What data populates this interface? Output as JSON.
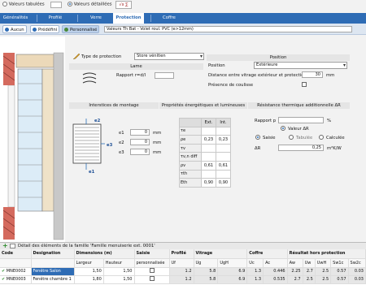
{
  "top": {
    "tabulated": "Valeurs tabulées",
    "detailed": "Valeurs détaillées",
    "formula": "√x ∑"
  },
  "tabs": [
    "Généralités",
    "Profilé",
    "Verre",
    "Protection",
    "Coffre"
  ],
  "active_tab": 3,
  "toolbar": {
    "none": "Aucun",
    "predefined": "Prédéfini",
    "custom": "Personnalisé",
    "title_field": "Valeurs Th Bat - Volet roul. PVC (e>12mm)"
  },
  "protection": {
    "type_label": "Type de protection",
    "type_value": "Store vénitien"
  },
  "lame": {
    "header": "Lame",
    "ratio_label": "Rapport r=d/l",
    "ratio_value": ""
  },
  "position": {
    "header": "Position",
    "pos_label": "Position",
    "pos_value": "Extérieure",
    "dist_label": "Distance entre vitrage extérieur et protection",
    "dist_value": "30",
    "dist_unit": "mm",
    "coulisse_label": "Présence de coulisse"
  },
  "sections": {
    "interstices": "Interstices de montage",
    "energie": "Propriétés énergétiques et lumineuses",
    "resistance": "Résistance thermique additionnelle ΔR"
  },
  "drawing": {
    "e2": "e2",
    "e3": "e3",
    "e1": "e1"
  },
  "interstices": [
    {
      "label": "e1",
      "value": "0",
      "unit": "mm"
    },
    {
      "label": "e2",
      "value": "0",
      "unit": "mm"
    },
    {
      "label": "e3",
      "value": "0",
      "unit": "mm"
    }
  ],
  "perf": {
    "headers": [
      "Ext.",
      "Int."
    ],
    "rows": [
      {
        "k": "τe",
        "ext": "",
        "int": ""
      },
      {
        "k": "ρe",
        "ext": "0,23",
        "int": "0,23"
      },
      {
        "k": "τv",
        "ext": "",
        "int": ""
      },
      {
        "k": "τv,n diff",
        "ext": "",
        "int": ""
      },
      {
        "k": "ρv",
        "ext": "0,61",
        "int": "0,61"
      },
      {
        "k": "τth",
        "ext": "",
        "int": ""
      },
      {
        "k": "Eth",
        "ext": "0,90",
        "int": "0,90"
      }
    ]
  },
  "resistance": {
    "rapport_label": "Rapport p",
    "rapport_value": "",
    "rapport_unit": "%",
    "valeur_label": "Valeur ΔR",
    "saisie": "Saisie",
    "tabulee": "Tabulée",
    "calculee": "Calculée",
    "dr_label": "ΔR",
    "dr_value": "0,25",
    "dr_unit": "m²K/W"
  },
  "details": {
    "title": "Détail des éléments de la famille 'Famille menuiserie ext. 0001'"
  },
  "grid": {
    "groups": [
      "Code",
      "Designation",
      "Dimensions (m)",
      "Saisie",
      "Profilé",
      "Vitrage",
      "Coffre",
      "Résultat hors protection"
    ],
    "sub": [
      "Largeur",
      "Hauteur",
      "personnalisée",
      "Uf",
      "Ug",
      "UgH",
      "Uc",
      "Ac",
      "Aw",
      "Uw",
      "UwH",
      "Sw1c",
      "Sw2c"
    ],
    "rows": [
      {
        "code": "MNE0002",
        "designation": "Fenêtre Salon",
        "largeur": "1,50",
        "hauteur": "1,50",
        "uf": "1.2",
        "ug": "5.8",
        "ugh": "6.9",
        "uc": "1.3",
        "ac": "0.446",
        "aw": "2.25",
        "uw": "2.7",
        "uwh": "2.5",
        "sw1c": "0.57",
        "sw2c": "0.03"
      },
      {
        "code": "MNE0003",
        "designation": "Fenêtre chambre 1",
        "largeur": "1,80",
        "hauteur": "1,50",
        "uf": "1.2",
        "ug": "5.8",
        "ugh": "6.9",
        "uc": "1.3",
        "ac": "0.535",
        "aw": "2.7",
        "uw": "2.5",
        "uwh": "2.5",
        "sw1c": "0.57",
        "sw2c": "0.03"
      }
    ]
  }
}
